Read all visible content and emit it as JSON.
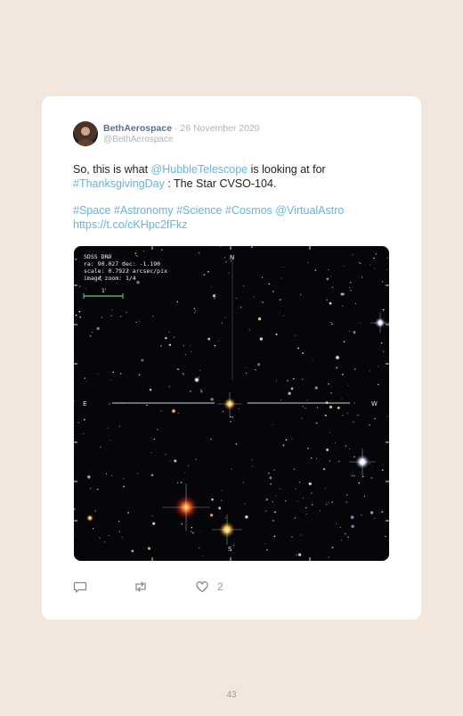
{
  "tweet": {
    "display_name": "BethAerospace",
    "separator": "·",
    "date": "26 November 2020",
    "handle": "@BethAerospace",
    "line1": {
      "prefix": "So, this is what ",
      "mention": "@HubbleTelescope",
      "middle": " is looking at for ",
      "hashtag": "#ThanksgivingDay",
      "suffix": " : The Star CVSO-104."
    },
    "tags": {
      "space": "#Space",
      "astronomy": "#Astronomy",
      "science": "#Science",
      "cosmos": "#Cosmos",
      "virtualastro": "@VirtualAstro"
    },
    "link": "https://t.co/cKHpc2fFkz"
  },
  "image": {
    "overlay": {
      "line1": "SDSS DR9",
      "line2": "ra: 90.027 dec: -1.190",
      "line3": "scale: 0.7922 arcsec/pix",
      "line4": "image zoom: 1/4",
      "scale_label": "1'"
    },
    "compass": {
      "north": "N",
      "south": "S",
      "east": "E",
      "west": "W"
    }
  },
  "actions": {
    "reply_icon": "speech-bubble-icon",
    "retweet_icon": "retweet-icon",
    "like_icon": "heart-icon",
    "like_count": "2"
  },
  "page": {
    "number": "43"
  },
  "colors": {
    "page_bg": "#f3e7dd",
    "card_bg": "#ffffff",
    "link": "#5fb6e4",
    "name": "#5a6f84",
    "muted": "#aab5c0"
  }
}
